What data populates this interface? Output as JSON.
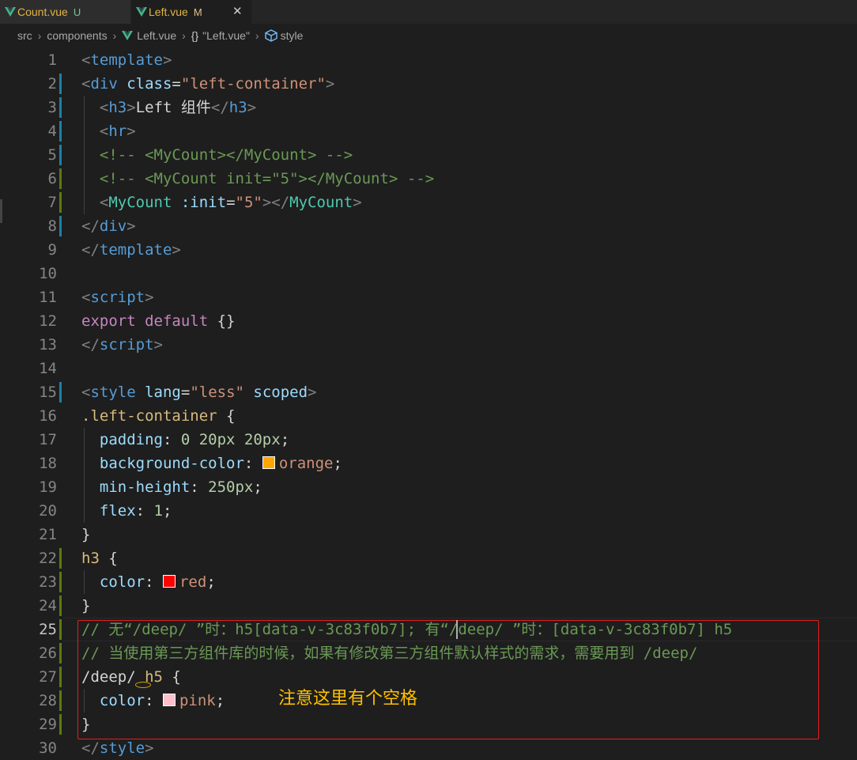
{
  "tabs": [
    {
      "label": "Count.vue",
      "status": "U"
    },
    {
      "label": "Left.vue",
      "status": "M",
      "close": "✕"
    }
  ],
  "breadcrumb": {
    "items": [
      "src",
      "components",
      "Left.vue",
      "\"Left.vue\"",
      "style"
    ],
    "braces": "{}"
  },
  "lines": [
    {
      "n": "1",
      "gutter": "",
      "indent": false,
      "tokens": [
        [
          "t-punc",
          "<"
        ],
        [
          "t-tag",
          "template"
        ],
        [
          "t-punc",
          ">"
        ]
      ]
    },
    {
      "n": "2",
      "gutter": "modified",
      "indent": false,
      "tokens": [
        [
          "t-punc",
          "<"
        ],
        [
          "t-tag",
          "div "
        ],
        [
          "t-attr",
          "class"
        ],
        [
          "t-text",
          "="
        ],
        [
          "t-str",
          "\"left-container\""
        ],
        [
          "t-punc",
          ">"
        ]
      ]
    },
    {
      "n": "3",
      "gutter": "modified",
      "indent": true,
      "tokens": [
        [
          "t-text",
          "  "
        ],
        [
          "t-punc",
          "<"
        ],
        [
          "t-tag",
          "h3"
        ],
        [
          "t-punc",
          ">"
        ],
        [
          "t-text",
          "Left 组件"
        ],
        [
          "t-punc",
          "</"
        ],
        [
          "t-tag",
          "h3"
        ],
        [
          "t-punc",
          ">"
        ]
      ]
    },
    {
      "n": "4",
      "gutter": "modified",
      "indent": true,
      "tokens": [
        [
          "t-text",
          "  "
        ],
        [
          "t-punc",
          "<"
        ],
        [
          "t-tag",
          "hr"
        ],
        [
          "t-punc",
          ">"
        ]
      ]
    },
    {
      "n": "5",
      "gutter": "modified",
      "indent": true,
      "tokens": [
        [
          "t-text",
          "  "
        ],
        [
          "t-comment",
          "<!-- <MyCount></MyCount> -->"
        ]
      ]
    },
    {
      "n": "6",
      "gutter": "added",
      "indent": true,
      "tokens": [
        [
          "t-text",
          "  "
        ],
        [
          "t-comment",
          "<!-- <MyCount init=\"5\"></MyCount> -->"
        ]
      ]
    },
    {
      "n": "7",
      "gutter": "added",
      "indent": true,
      "tokens": [
        [
          "t-text",
          "  "
        ],
        [
          "t-punc",
          "<"
        ],
        [
          "t-comp",
          "MyCount "
        ],
        [
          "t-attr",
          ":init"
        ],
        [
          "t-text",
          "="
        ],
        [
          "t-str",
          "\"5\""
        ],
        [
          "t-punc",
          "></"
        ],
        [
          "t-comp",
          "MyCount"
        ],
        [
          "t-punc",
          ">"
        ]
      ]
    },
    {
      "n": "8",
      "gutter": "modified",
      "indent": false,
      "tokens": [
        [
          "t-punc",
          "</"
        ],
        [
          "t-tag",
          "div"
        ],
        [
          "t-punc",
          ">"
        ]
      ]
    },
    {
      "n": "9",
      "gutter": "",
      "indent": false,
      "tokens": [
        [
          "t-punc",
          "</"
        ],
        [
          "t-tag",
          "template"
        ],
        [
          "t-punc",
          ">"
        ]
      ]
    },
    {
      "n": "10",
      "gutter": "",
      "indent": false,
      "tokens": []
    },
    {
      "n": "11",
      "gutter": "",
      "indent": false,
      "tokens": [
        [
          "t-punc",
          "<"
        ],
        [
          "t-tag",
          "script"
        ],
        [
          "t-punc",
          ">"
        ]
      ]
    },
    {
      "n": "12",
      "gutter": "",
      "indent": false,
      "tokens": [
        [
          "t-kw",
          "export default "
        ],
        [
          "t-text",
          "{}"
        ]
      ]
    },
    {
      "n": "13",
      "gutter": "",
      "indent": false,
      "tokens": [
        [
          "t-punc",
          "</"
        ],
        [
          "t-tag",
          "script"
        ],
        [
          "t-punc",
          ">"
        ]
      ]
    },
    {
      "n": "14",
      "gutter": "",
      "indent": false,
      "tokens": []
    },
    {
      "n": "15",
      "gutter": "modified",
      "indent": false,
      "tokens": [
        [
          "t-punc",
          "<"
        ],
        [
          "t-tag",
          "style "
        ],
        [
          "t-attr",
          "lang"
        ],
        [
          "t-text",
          "="
        ],
        [
          "t-str",
          "\"less\""
        ],
        [
          "t-text",
          " "
        ],
        [
          "t-attr",
          "scoped"
        ],
        [
          "t-punc",
          ">"
        ]
      ]
    },
    {
      "n": "16",
      "gutter": "",
      "indent": false,
      "tokens": [
        [
          "t-sel",
          ".left-container"
        ],
        [
          "t-text",
          " {"
        ]
      ]
    },
    {
      "n": "17",
      "gutter": "",
      "indent": true,
      "tokens": [
        [
          "t-text",
          "  "
        ],
        [
          "t-prop",
          "padding"
        ],
        [
          "t-text",
          ": "
        ],
        [
          "t-num",
          "0 20px 20px"
        ],
        [
          "t-text",
          ";"
        ]
      ]
    },
    {
      "n": "18",
      "gutter": "",
      "indent": true,
      "tokens": [
        [
          "t-text",
          "  "
        ],
        [
          "t-prop",
          "background-color"
        ],
        [
          "t-text",
          ": "
        ],
        [
          "swatch",
          "#ffa500"
        ],
        [
          "t-val",
          "orange"
        ],
        [
          "t-text",
          ";"
        ]
      ]
    },
    {
      "n": "19",
      "gutter": "",
      "indent": true,
      "tokens": [
        [
          "t-text",
          "  "
        ],
        [
          "t-prop",
          "min-height"
        ],
        [
          "t-text",
          ": "
        ],
        [
          "t-num",
          "250px"
        ],
        [
          "t-text",
          ";"
        ]
      ]
    },
    {
      "n": "20",
      "gutter": "",
      "indent": true,
      "tokens": [
        [
          "t-text",
          "  "
        ],
        [
          "t-prop",
          "flex"
        ],
        [
          "t-text",
          ": "
        ],
        [
          "t-num",
          "1"
        ],
        [
          "t-text",
          ";"
        ]
      ]
    },
    {
      "n": "21",
      "gutter": "",
      "indent": false,
      "tokens": [
        [
          "t-text",
          "}"
        ]
      ]
    },
    {
      "n": "22",
      "gutter": "added",
      "indent": false,
      "tokens": [
        [
          "t-sel",
          "h3"
        ],
        [
          "t-text",
          " {"
        ]
      ]
    },
    {
      "n": "23",
      "gutter": "added",
      "indent": true,
      "tokens": [
        [
          "t-text",
          "  "
        ],
        [
          "t-prop",
          "color"
        ],
        [
          "t-text",
          ": "
        ],
        [
          "swatch",
          "#ff0000"
        ],
        [
          "t-val",
          "red"
        ],
        [
          "t-text",
          ";"
        ]
      ]
    },
    {
      "n": "24",
      "gutter": "added",
      "indent": false,
      "tokens": [
        [
          "t-text",
          "}"
        ]
      ]
    },
    {
      "n": "25",
      "gutter": "added",
      "indent": false,
      "active": true,
      "tokens": [
        [
          "t-comment",
          "// 无“/deep/ ”时：h5[data-v-3c83f0b7]; 有“/deep/ ”时：[data-v-3c83f0b7] h5"
        ]
      ]
    },
    {
      "n": "26",
      "gutter": "added",
      "indent": false,
      "tokens": [
        [
          "t-comment",
          "// 当使用第三方组件库的时候，如果有修改第三方组件默认样式的需求，需要用到 /deep/"
        ]
      ]
    },
    {
      "n": "27",
      "gutter": "added",
      "indent": false,
      "tokens": [
        [
          "t-text",
          "/deep/ "
        ],
        [
          "t-sel",
          "h5"
        ],
        [
          "t-text",
          " {"
        ]
      ]
    },
    {
      "n": "28",
      "gutter": "added",
      "indent": true,
      "tokens": [
        [
          "t-text",
          "  "
        ],
        [
          "t-prop",
          "color"
        ],
        [
          "t-text",
          ": "
        ],
        [
          "swatch",
          "#ffc0cb"
        ],
        [
          "t-val",
          "pink"
        ],
        [
          "t-text",
          ";"
        ]
      ]
    },
    {
      "n": "29",
      "gutter": "added",
      "indent": false,
      "tokens": [
        [
          "t-text",
          "}"
        ]
      ]
    },
    {
      "n": "30",
      "gutter": "",
      "indent": false,
      "tokens": [
        [
          "t-punc",
          "</"
        ],
        [
          "t-tag",
          "style"
        ],
        [
          "t-punc",
          ">"
        ]
      ]
    }
  ],
  "annotation": {
    "text": "注意这里有个空格",
    "box_color": "#e02020",
    "text_color": "#ffc000"
  },
  "colors": {
    "editor_bg": "#1e1e1e",
    "vue_green": "#41b883",
    "vue_dark": "#34495e"
  }
}
